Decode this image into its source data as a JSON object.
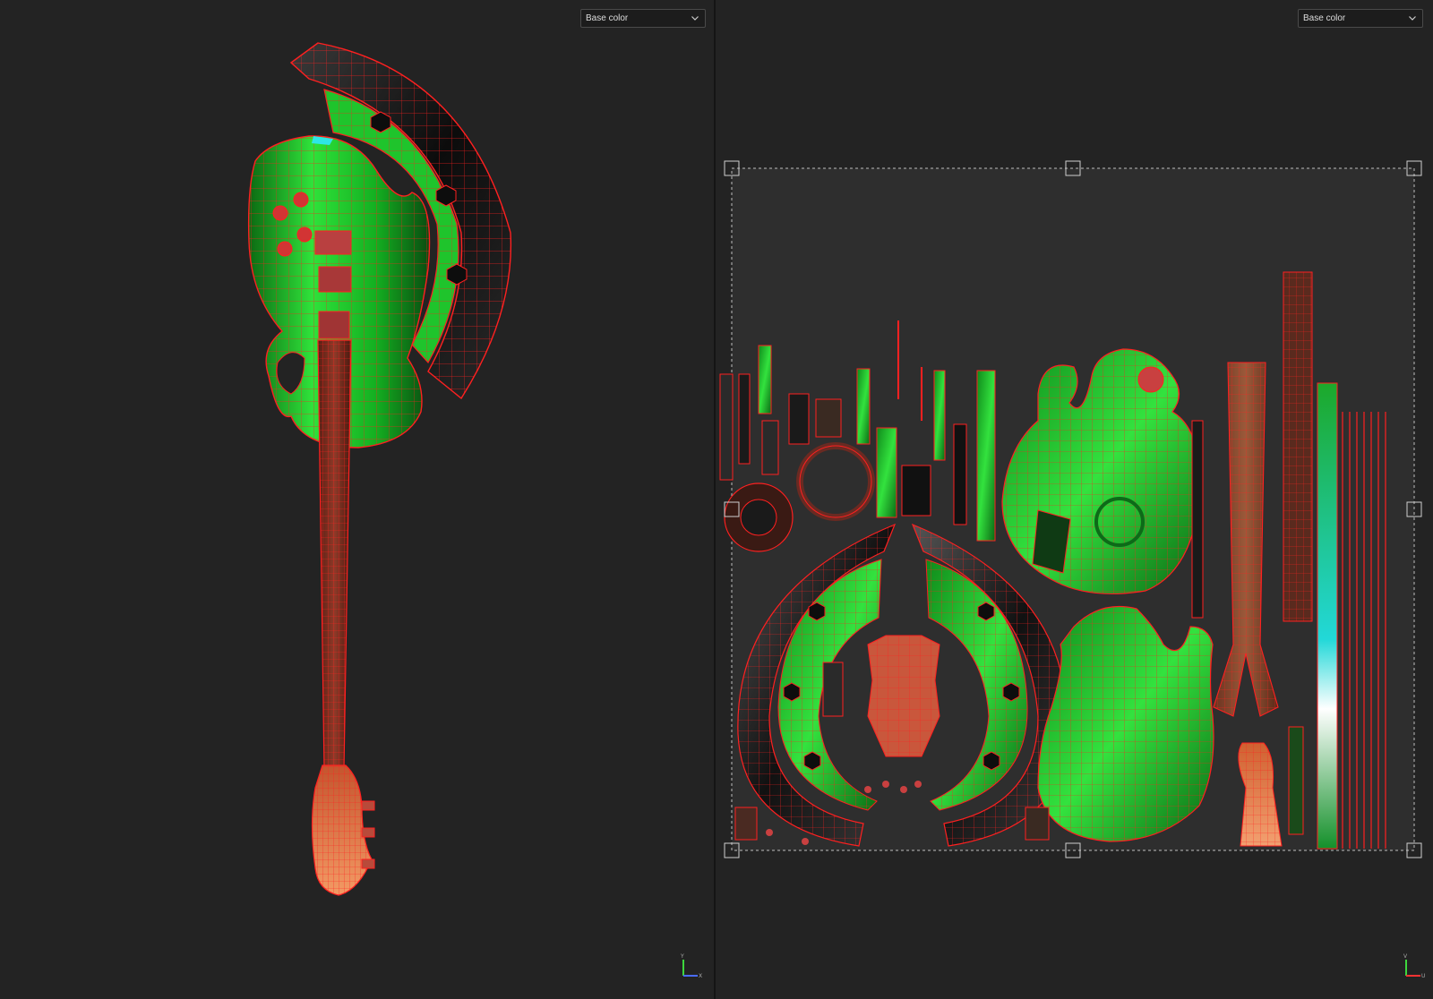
{
  "viewport_3d": {
    "channel_select": {
      "value": "Base color"
    },
    "axis_gizmo": {
      "y": "Y",
      "x": "X"
    }
  },
  "viewport_uv": {
    "channel_select": {
      "value": "Base color"
    },
    "axis_gizmo": {
      "v": "V",
      "u": "U"
    }
  },
  "colors": {
    "background": "#232323",
    "wireframe": "#ff2020",
    "albedo_green": "#19c42a",
    "uv_tile": "#2e2e2e"
  },
  "icons": [
    "chevron-down-icon",
    "axis-gizmo-icon",
    "transform-handle-icon"
  ]
}
